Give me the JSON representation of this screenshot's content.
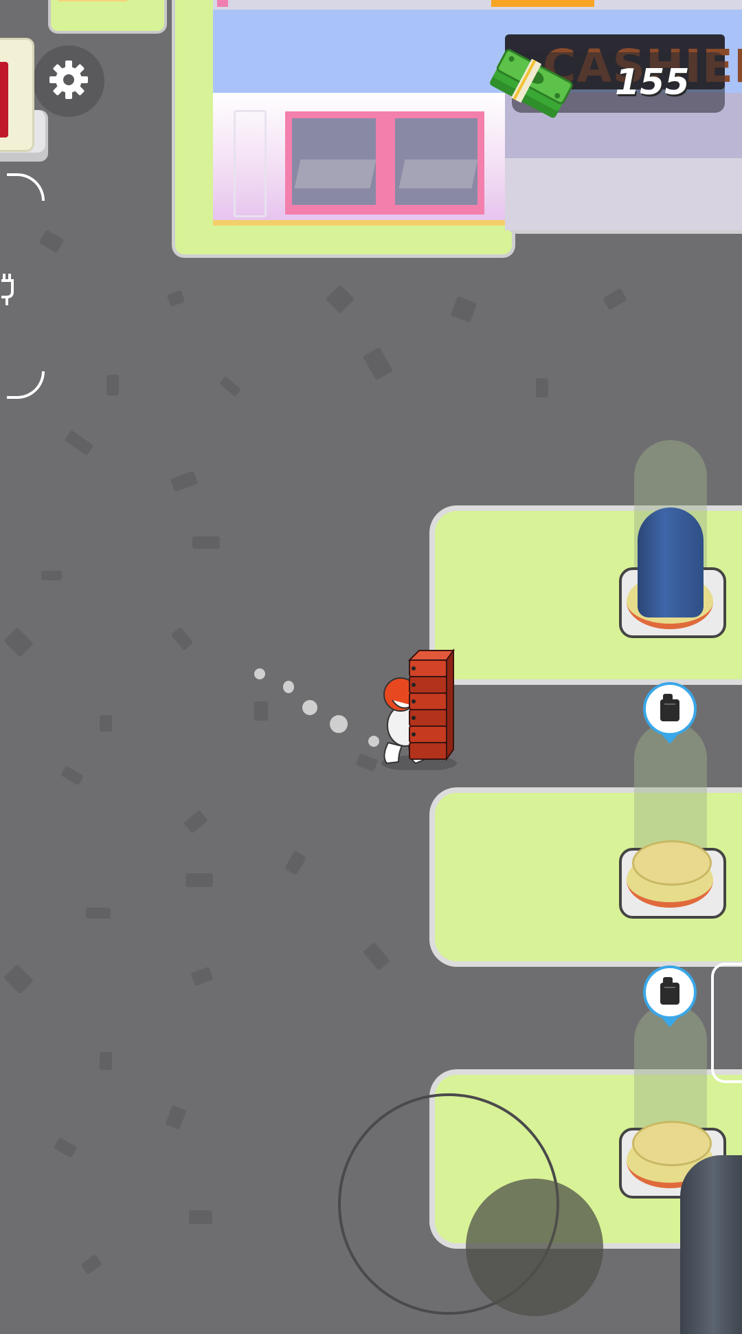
{
  "hud": {
    "money_value": "155",
    "money_icon": "cash-stack-icon",
    "settings_icon": "gear-icon"
  },
  "scene": {
    "cashier_sign_text": "CASHIER",
    "pad_icon": "gas-canister-icon",
    "player_item": "gas-canister-stack"
  },
  "colors": {
    "ground": "#6e6e70",
    "pad_green": "#d8f297",
    "pin_blue": "#3aa7e8",
    "tank_blue": "#3f66a8",
    "roof_blue": "#a9c3f8"
  }
}
